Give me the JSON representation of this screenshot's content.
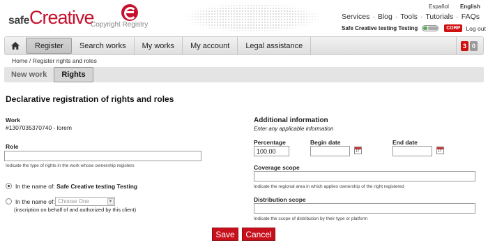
{
  "brand": {
    "logo_safe": "safe",
    "logo_creative": "Creative",
    "tagline": "Copyright Registry"
  },
  "header": {
    "lang_es": "Español",
    "lang_en": "English",
    "topnav": [
      "Services",
      "Blog",
      "Tools",
      "Tutorials",
      "FAQs"
    ],
    "username": "Safe Creative testing Testing",
    "corp_badge": "CORP",
    "logout": "Log out"
  },
  "navbar": {
    "items": [
      "Register",
      "Search works",
      "My works",
      "My account",
      "Legal assistance"
    ],
    "active": "Register",
    "badge_red": "3",
    "badge_grey": "0"
  },
  "breadcrumb": "Home / Register rights and roles",
  "subtabs": {
    "items": [
      "New work",
      "Rights"
    ],
    "active": "Rights"
  },
  "page_title": "Declarative registration of rights and roles",
  "left": {
    "work_label": "Work",
    "work_value": "#1307035370740 - lorem",
    "role_label": "Role",
    "role_value": "",
    "role_help": "Indicate the type of rights in the work whose ownership registers",
    "radio1_prefix": "In the name of:",
    "radio1_name": "Safe Creative testing Testing",
    "radio2_prefix": "In the name of:",
    "radio2_select": "Choose One",
    "radio2_note": "(inscription on behalf of and authorized by this client)"
  },
  "right": {
    "title": "Additional information",
    "subtitle": "Enter any applicable information",
    "percentage_label": "Percentage",
    "percentage_value": "100.00",
    "begin_label": "Begin date",
    "end_label": "End date",
    "coverage_label": "Coverage scope",
    "coverage_help": "Indicate the regional area in which applies ownership of the right registered",
    "distribution_label": "Distribution scope",
    "distribution_help": "Indicate the scope of distribution by their type or platform"
  },
  "buttons": {
    "save": "Save",
    "cancel": "Cancel"
  },
  "colors": {
    "brand_red": "#c8102e",
    "button_red": "#c8101c"
  }
}
